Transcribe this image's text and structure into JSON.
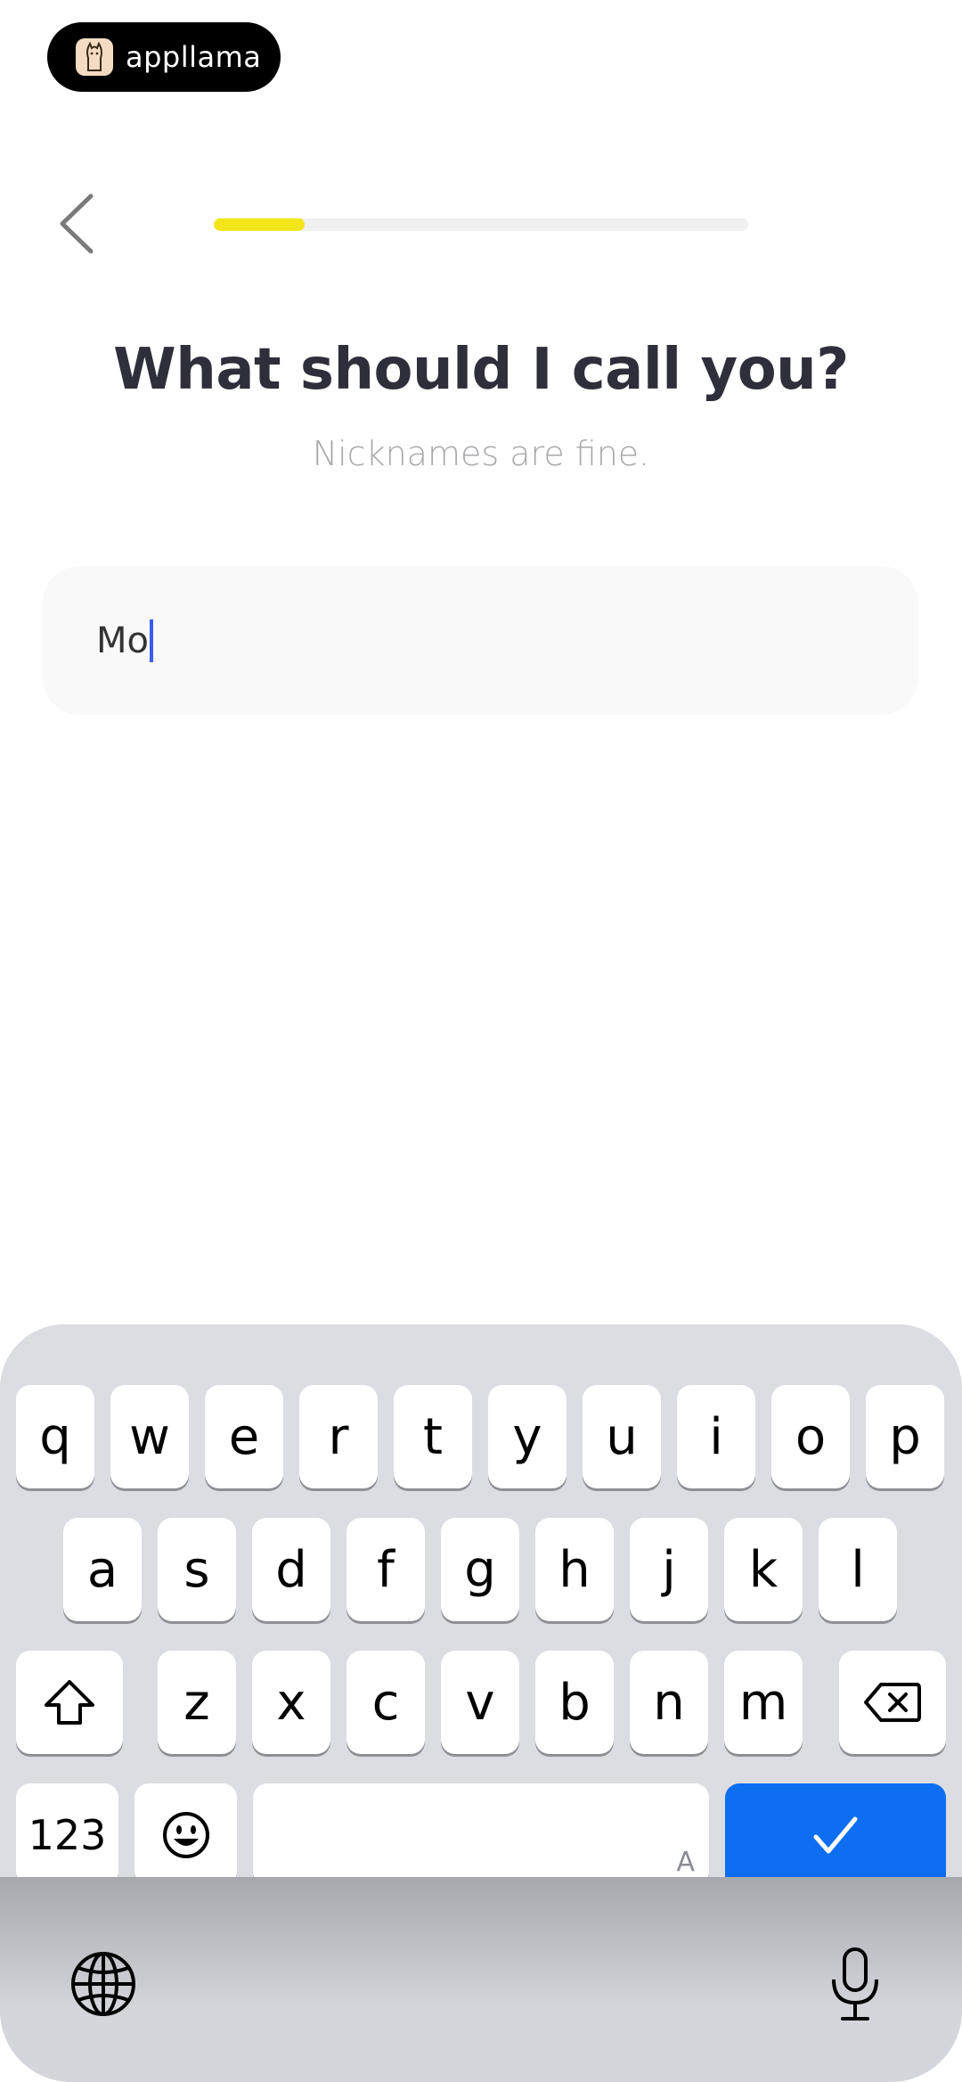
{
  "brand": {
    "name": "appllama",
    "logo_icon": "llama-logo-icon"
  },
  "header": {
    "back_icon": "chevron-left-icon",
    "progress": 0.17
  },
  "title": "What should I call you?",
  "subtitle": "Nicknames are fine.",
  "input": {
    "value": "Mo",
    "caret_color": "#3d5af1"
  },
  "colors": {
    "progress_fill": "#f2e51a",
    "confirm_key": "#0d6ef2"
  },
  "keyboard": {
    "row1": [
      "q",
      "w",
      "e",
      "r",
      "t",
      "y",
      "u",
      "i",
      "o",
      "p"
    ],
    "row2": [
      "a",
      "s",
      "d",
      "f",
      "g",
      "h",
      "j",
      "k",
      "l"
    ],
    "row3": [
      "z",
      "x",
      "c",
      "v",
      "b",
      "n",
      "m"
    ],
    "numbers_label": "123",
    "space_hint": "A",
    "icons": {
      "shift": "shift-icon",
      "backspace": "backspace-icon",
      "emoji": "emoji-icon",
      "confirm": "checkmark-icon",
      "globe": "globe-icon",
      "mic": "microphone-icon"
    }
  }
}
